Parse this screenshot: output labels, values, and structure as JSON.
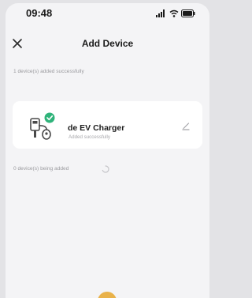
{
  "status_bar": {
    "time": "09:48",
    "icons": [
      "signal-icon",
      "wifi-icon",
      "battery-icon"
    ]
  },
  "nav": {
    "title": "Add Device",
    "close_icon": "close-icon"
  },
  "added_section": {
    "label": "1 device(s) added successfully"
  },
  "device": {
    "name": "de EV Charger",
    "status": "Added successfully",
    "icon": "ev-charger-icon",
    "badge_icon": "check-icon",
    "edit_icon": "pencil-icon"
  },
  "adding_section": {
    "label": "0 device(s) being added",
    "spinner_icon": "loading-spinner-icon"
  },
  "colors": {
    "accent_green": "#2fb37a",
    "background": "#f4f4f6",
    "card": "#ffffff",
    "home_indicator": "#e9b24a"
  }
}
